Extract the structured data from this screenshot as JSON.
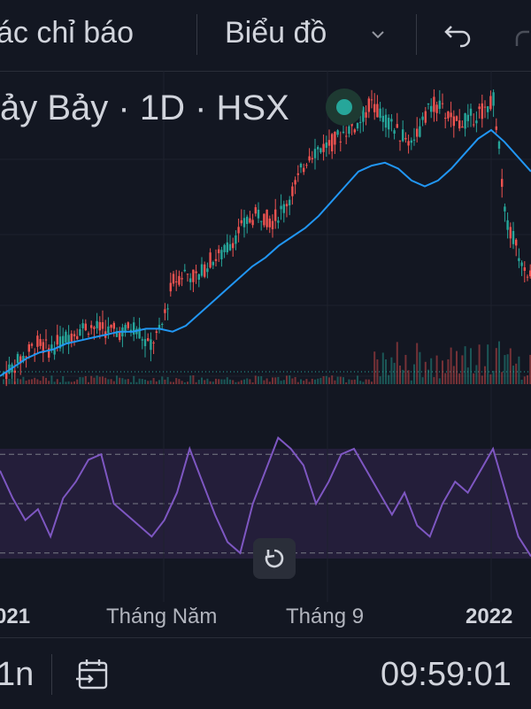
{
  "toolbar": {
    "indicators_label": "ác chỉ báo",
    "chart_type_label": "Biểu đồ",
    "chevron_icon": "chevron-down-icon",
    "undo_icon": "undo-icon",
    "redo_icon": "redo-icon"
  },
  "symbol": {
    "text": "ảy Bảy · 1D · HSX",
    "status_color": "#26a69a"
  },
  "colors": {
    "up": "#26a69a",
    "down": "#ef5350",
    "ma": "#2196f3",
    "oscillator": "#7e57c2"
  },
  "x_axis": {
    "labels": [
      "021",
      "Tháng Năm",
      "Tháng 9",
      "2022"
    ]
  },
  "bottom_bar": {
    "interval": "1n",
    "date_range_icon": "calendar-range-icon",
    "time": "09:59:01"
  },
  "chart_data": [
    {
      "type": "line",
      "series": [
        {
          "values": [
            0.03,
            0.06,
            0.1,
            0.14,
            0.12,
            0.15,
            0.18,
            0.2,
            0.19,
            0.18,
            0.18,
            0.2,
            0.13,
            0.18,
            0.35,
            0.38,
            0.36,
            0.42,
            0.44,
            0.5,
            0.55,
            0.58,
            0.55,
            0.6,
            0.68,
            0.78,
            0.8,
            0.82,
            0.86,
            0.88,
            0.95,
            0.9,
            0.86,
            0.82,
            0.86,
            0.95,
            0.92,
            0.88,
            0.9,
            0.92,
            0.97,
            0.55,
            0.45,
            0.36
          ]
        },
        {
          "values": [
            0.03,
            0.06,
            0.09,
            0.11,
            0.12,
            0.14,
            0.15,
            0.16,
            0.17,
            0.18,
            0.18,
            0.19,
            0.19,
            0.18,
            0.2,
            0.24,
            0.28,
            0.32,
            0.36,
            0.4,
            0.43,
            0.47,
            0.5,
            0.53,
            0.57,
            0.62,
            0.67,
            0.72,
            0.74,
            0.75,
            0.73,
            0.69,
            0.67,
            0.69,
            0.73,
            0.78,
            0.83,
            0.86,
            0.82,
            0.77,
            0.72
          ]
        }
      ]
    },
    {
      "type": "line",
      "levels": [
        0.95,
        0.5,
        0.05
      ],
      "values": [
        0.8,
        0.55,
        0.35,
        0.45,
        0.2,
        0.55,
        0.7,
        0.9,
        0.95,
        0.5,
        0.4,
        0.3,
        0.2,
        0.35,
        0.6,
        1.0,
        0.7,
        0.4,
        0.15,
        0.05,
        0.5,
        0.8,
        1.1,
        1.0,
        0.85,
        0.5,
        0.7,
        0.95,
        1.0,
        0.8,
        0.6,
        0.4,
        0.6,
        0.3,
        0.2,
        0.5,
        0.7,
        0.6,
        0.8,
        1.0,
        0.6,
        0.2,
        0.02
      ]
    }
  ]
}
